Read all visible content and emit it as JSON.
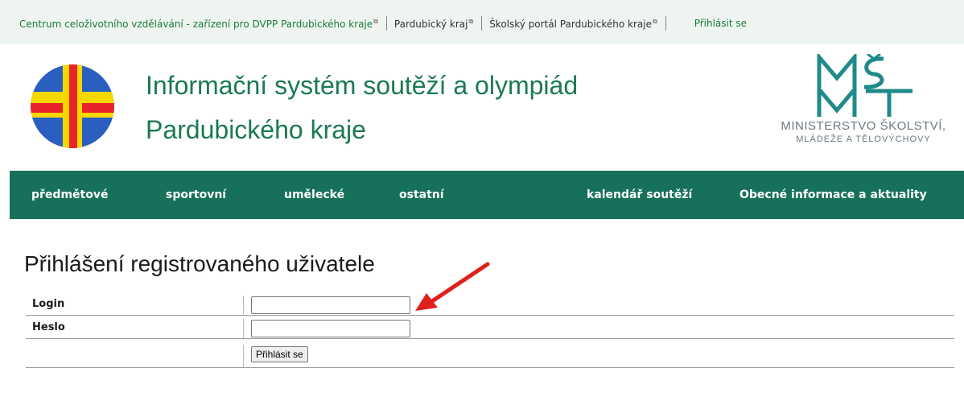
{
  "top_links": {
    "cdv": "Centrum celoživotního vzdělávání - zařízení pro DVPP Pardubického kraje",
    "kraj": "Pardubický kraj",
    "portal": "Školský portál Pardubického kraje",
    "login": "Přihlásit se"
  },
  "header": {
    "title_line1": "Informační systém soutěží a olympiád",
    "title_line2": "Pardubického kraje",
    "msmt_line1": "MINISTERSTVO ŠKOLSTVÍ,",
    "msmt_line2": "MLÁDEŽE A TĚLOVÝCHOVY"
  },
  "nav": {
    "items": [
      "předmětové",
      "sportovní",
      "umělecké",
      "ostatní",
      "kalendář soutěží",
      "Obecné informace a aktuality"
    ]
  },
  "login_form": {
    "heading": "Přihlášení registrovaného uživatele",
    "login_label": "Login",
    "login_value": "",
    "password_label": "Heslo",
    "password_value": "",
    "submit_label": "Přihlásit se"
  },
  "colors": {
    "nav_bg": "#17705a",
    "title_green": "#1a7a52",
    "link_green": "#1a7a3c",
    "arrow_red": "#e0201c"
  }
}
